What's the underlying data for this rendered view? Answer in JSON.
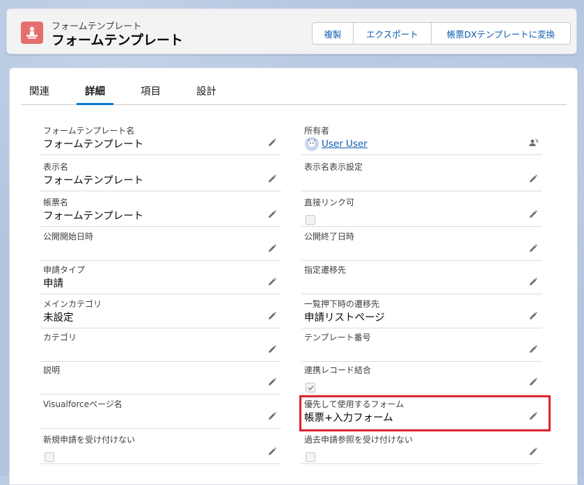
{
  "header": {
    "object_type": "フォームテンプレート",
    "record_name": "フォームテンプレート",
    "buttons": [
      "複製",
      "エクスポート",
      "帳票DXテンプレートに変換"
    ]
  },
  "tabs": [
    "関連",
    "詳細",
    "項目",
    "設計"
  ],
  "active_tab": "詳細",
  "fields_left": [
    {
      "label": "フォームテンプレート名",
      "value": "フォームテンプレート"
    },
    {
      "label": "表示名",
      "value": "フォームテンプレート"
    },
    {
      "label": "帳票名",
      "value": "フォームテンプレート"
    },
    {
      "label": "公開開始日時",
      "value": ""
    },
    {
      "label": "申請タイプ",
      "value": "申請"
    },
    {
      "label": "メインカテゴリ",
      "value": "未設定"
    },
    {
      "label": "カテゴリ",
      "value": ""
    },
    {
      "label": "説明",
      "value": ""
    },
    {
      "label": "Visualforceページ名",
      "value": ""
    },
    {
      "label": "新規申請を受け付けない",
      "checkbox": false
    }
  ],
  "fields_right": [
    {
      "label": "所有者",
      "value": "User User"
    },
    {
      "label": "表示名表示設定",
      "value": ""
    },
    {
      "label": "直接リンク可",
      "checkbox": false
    },
    {
      "label": "公開終了日時",
      "value": ""
    },
    {
      "label": "指定遷移先",
      "value": ""
    },
    {
      "label": "一覧押下時の遷移先",
      "value": "申請リストページ"
    },
    {
      "label": "テンプレート番号",
      "value": ""
    },
    {
      "label": "連携レコード結合",
      "checkbox": true
    },
    {
      "label": "優先して使用するフォーム",
      "value": "帳票+入力フォーム"
    },
    {
      "label": "過去申請参照を受け付けない",
      "checkbox": false
    }
  ],
  "colors": {
    "accent": "#0176d3",
    "link": "#0b5cab",
    "highlight": "#e0202d",
    "app_icon": "#e56f6f"
  }
}
